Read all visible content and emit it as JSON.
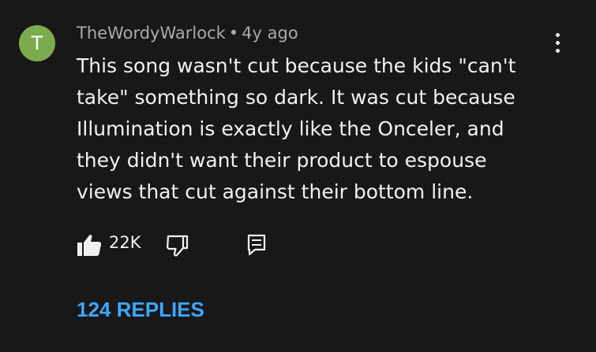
{
  "comment": {
    "avatar_initial": "T",
    "avatar_color": "#7cab4f",
    "author": "TheWordyWarlock",
    "separator": "•",
    "time": "4y ago",
    "text_lines": [
      "This song wasn't cut because the kids \"can't",
      "take\" something so dark. It was cut because",
      "Illumination is exactly like the Onceler, and",
      "they didn't want their product to espouse",
      "views that cut against their bottom line."
    ],
    "like_count": "22K",
    "replies_label": "124 REPLIES",
    "icons": {
      "like": "thumbs-up-icon",
      "dislike": "thumbs-down-icon",
      "reply": "reply-icon",
      "menu": "more-vert-icon"
    }
  },
  "colors": {
    "background": "#181818",
    "text": "#f1f1f1",
    "meta": "#aaaaaa",
    "link": "#3ea6ff"
  }
}
